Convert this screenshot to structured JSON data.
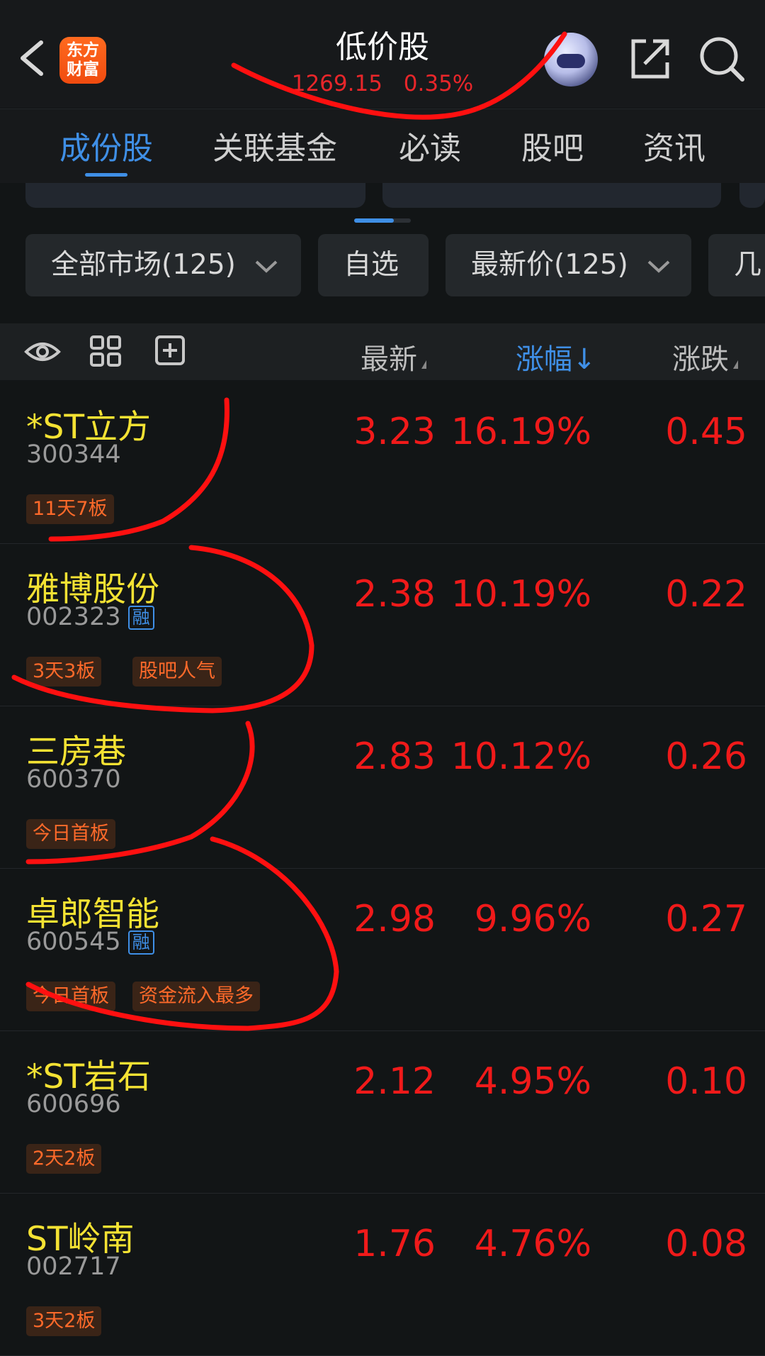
{
  "header": {
    "title": "低价股",
    "index_value": "1269.15",
    "index_change": "0.35%",
    "logo_line1": "东方",
    "logo_line2": "财富"
  },
  "tabs": [
    {
      "label": "成份股",
      "active": true
    },
    {
      "label": "关联基金"
    },
    {
      "label": "必读"
    },
    {
      "label": "股吧"
    },
    {
      "label": "资讯"
    }
  ],
  "filters": {
    "market": "全部市场(125)",
    "watchlist": "自选",
    "price": "最新价(125)",
    "more": "几"
  },
  "columns": {
    "latest": "最新",
    "change_pct": "涨幅",
    "change_pct_arrow": "↓",
    "change": "涨跌"
  },
  "stocks": [
    {
      "name": "*ST立方",
      "code": "300344",
      "rong": "",
      "tags": [
        "11天7板"
      ],
      "price": "3.23",
      "pct": "16.19%",
      "change": "0.45"
    },
    {
      "name": "雅博股份",
      "code": "002323",
      "rong": "融",
      "tags": [
        "3天3板",
        "股吧人气"
      ],
      "price": "2.38",
      "pct": "10.19%",
      "change": "0.22"
    },
    {
      "name": "三房巷",
      "code": "600370",
      "rong": "",
      "tags": [
        "今日首板"
      ],
      "price": "2.83",
      "pct": "10.12%",
      "change": "0.26"
    },
    {
      "name": "卓郎智能",
      "code": "600545",
      "rong": "融",
      "tags": [
        "今日首板",
        "资金流入最多"
      ],
      "price": "2.98",
      "pct": "9.96%",
      "change": "0.27"
    },
    {
      "name": "*ST岩石",
      "code": "600696",
      "rong": "",
      "tags": [
        "2天2板"
      ],
      "price": "2.12",
      "pct": "4.95%",
      "change": "0.10"
    },
    {
      "name": "ST岭南",
      "code": "002717",
      "rong": "",
      "tags": [
        "3天2板"
      ],
      "price": "1.76",
      "pct": "4.76%",
      "change": "0.08"
    }
  ],
  "colors": {
    "background": "#121516",
    "accent_blue": "#3f8fe6",
    "rise_red": "#f01a1a",
    "stock_name_yellow": "#f4e233",
    "tag_orange": "#ff6a2a",
    "annotation_red": "#ff1010"
  }
}
